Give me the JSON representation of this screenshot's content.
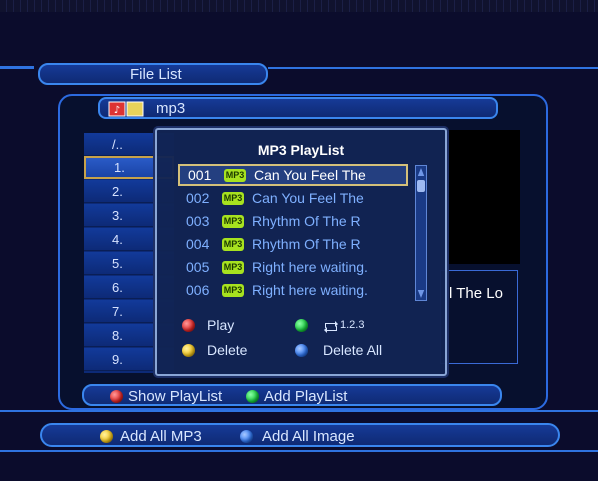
{
  "header": {
    "title": "File List"
  },
  "path": {
    "label": "mp3"
  },
  "file_list": {
    "parent": "/..",
    "items": [
      "1.",
      "2.",
      "3.",
      "4.",
      "5.",
      "6.",
      "7.",
      "8.",
      "9."
    ],
    "selected_index": 0
  },
  "preview": {
    "partial_title": "l The Lo"
  },
  "playlist": {
    "title": "MP3 PlayList",
    "badge": "MP3",
    "items": [
      {
        "num": "001",
        "title": "Can You Feel The"
      },
      {
        "num": "002",
        "title": "Can You Feel The"
      },
      {
        "num": "003",
        "title": "Rhythm Of The R"
      },
      {
        "num": "004",
        "title": "Rhythm Of The R"
      },
      {
        "num": "005",
        "title": "Right here waiting."
      },
      {
        "num": "006",
        "title": "Right here waiting."
      }
    ],
    "selected_index": 0,
    "controls": {
      "play": "Play",
      "repeat": "1.2.3",
      "delete": "Delete",
      "delete_all": "Delete All"
    }
  },
  "footer": {
    "show_playlist": "Show PlayList",
    "add_playlist": "Add PlayList",
    "add_all_mp3": "Add All MP3",
    "add_all_image": "Add All Image"
  },
  "colors": {
    "red": "#e02626",
    "green": "#16c93d",
    "yellow": "#f2c41a",
    "blue": "#2f77f2"
  }
}
